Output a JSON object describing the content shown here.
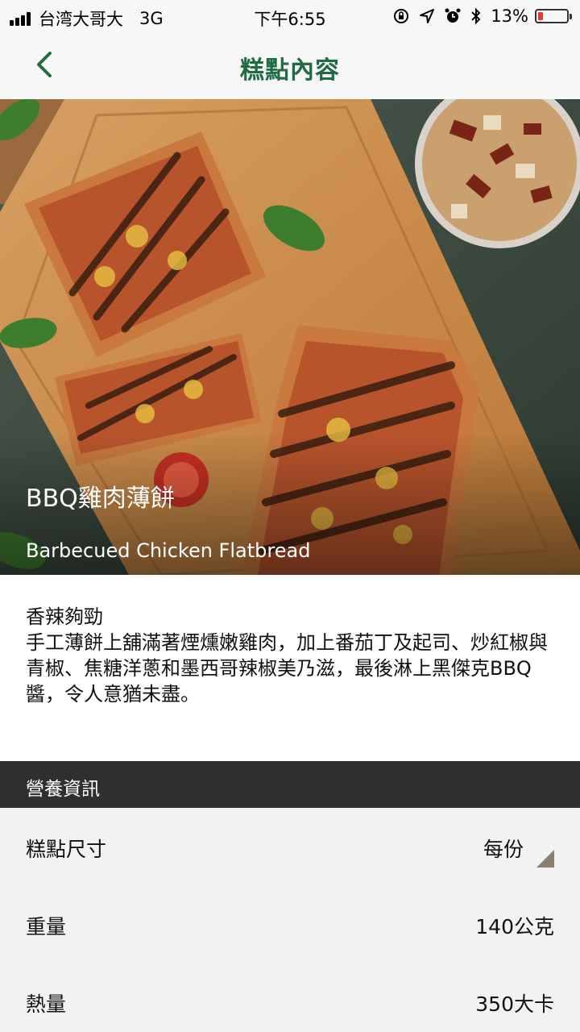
{
  "status_bar": {
    "carrier": "台湾大哥大",
    "network": "3G",
    "time": "下午6:55",
    "battery": "13%"
  },
  "nav": {
    "title": "糕點內容"
  },
  "product": {
    "name_zh": "BBQ雞肉薄餅",
    "name_en": "Barbecued Chicken Flatbread"
  },
  "description": {
    "tagline": "香辣夠勁",
    "body": "手工薄餅上舖滿著煙燻嫩雞肉，加上番茄丁及起司、炒紅椒與青椒、焦糖洋蔥和墨西哥辣椒美乃滋，最後淋上黑傑克BBQ醬，令人意猶未盡。"
  },
  "nutrition": {
    "header": "營養資訊",
    "rows": [
      {
        "label": "糕點尺寸",
        "value": "每份"
      },
      {
        "label": "重量",
        "value": "140公克"
      },
      {
        "label": "熱量",
        "value": "350大卡"
      }
    ]
  },
  "colors": {
    "accent": "#1f6b45",
    "section_header_bg": "#2f2f2f",
    "battery_low": "#e53935"
  }
}
